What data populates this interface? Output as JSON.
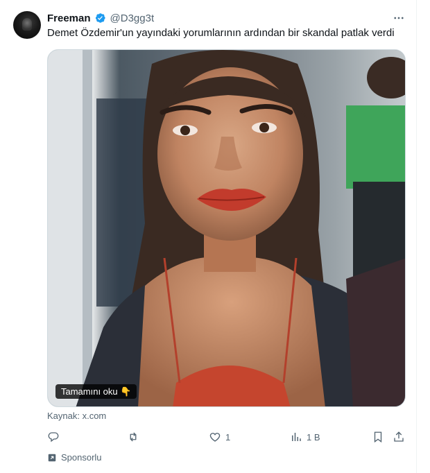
{
  "tweet": {
    "author_name": "Freeman",
    "author_handle": "@D3gg3t",
    "text": "Demet Özdemir'un yayındaki yorumlarının ardından bir skandal patlak verdi",
    "read_more_label": "Tamamını oku 👇",
    "source_label": "Kaynak: x.com",
    "sponsored_label": "Sponsorlu"
  },
  "actions": {
    "reply_count": "",
    "retweet_count": "",
    "like_count": "1",
    "views_count": "1 B"
  },
  "icons": {
    "verified": "verified-badge-icon",
    "more": "more-horizontal-icon",
    "reply": "reply-icon",
    "retweet": "retweet-icon",
    "like": "heart-icon",
    "views": "views-bar-chart-icon",
    "bookmark": "bookmark-icon",
    "share": "share-icon",
    "sponsor": "promoted-arrow-icon"
  },
  "colors": {
    "accent": "#1d9bf0",
    "muted_text": "#536471",
    "text": "#0f1419"
  }
}
